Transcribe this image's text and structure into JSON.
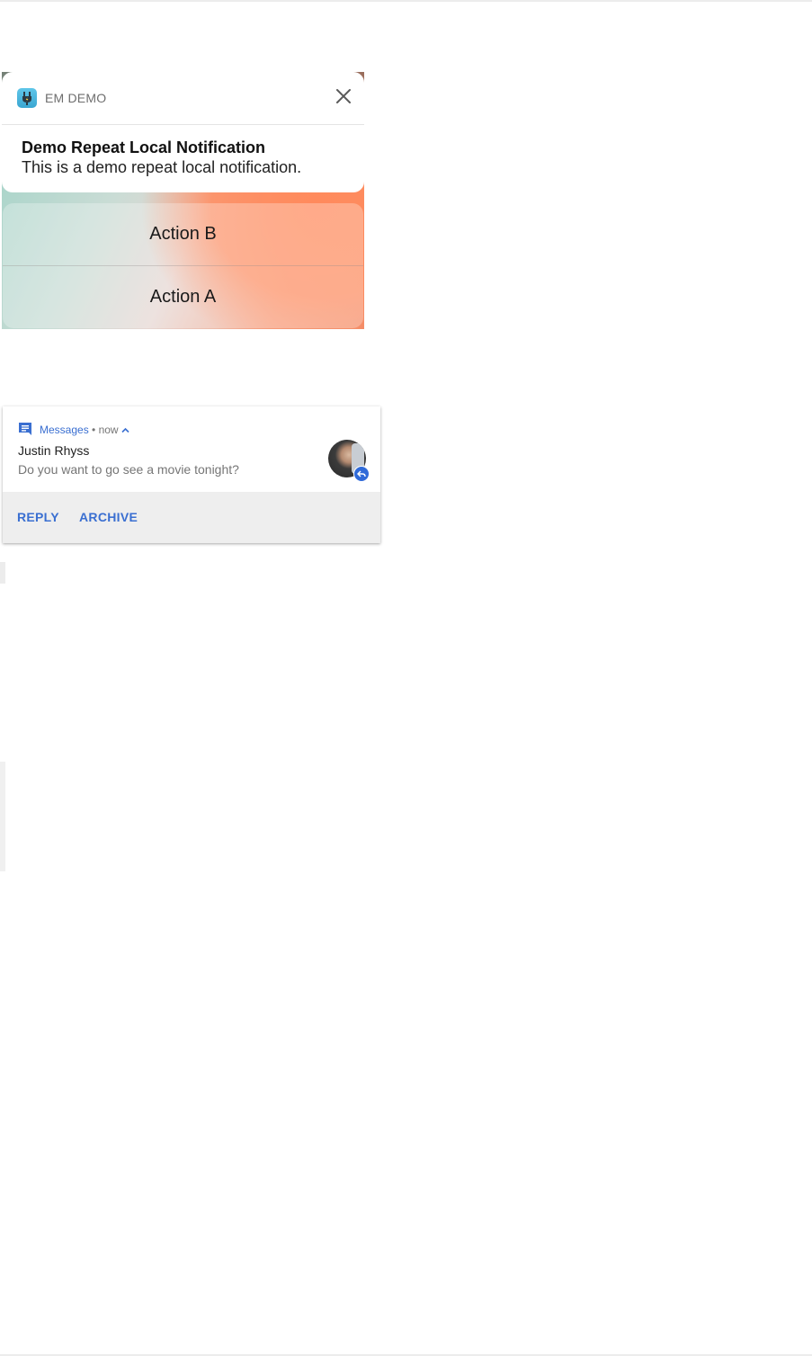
{
  "ios_notification": {
    "app_name": "EM DEMO",
    "app_icon": "plug-icon",
    "close_icon": "close-icon",
    "title": "Demo Repeat Local Notification",
    "body": "This is a demo repeat local notification.",
    "actions": [
      "Action B",
      "Action A"
    ]
  },
  "android_notification": {
    "app_name": "Messages",
    "time": "• now",
    "app_icon": "messages-icon",
    "expand_icon": "chevron-up-icon",
    "sender": "Justin Rhyss",
    "message": "Do you want to go see a movie tonight?",
    "actions": [
      "REPLY",
      "ARCHIVE"
    ],
    "accent_color": "#3a6fd1"
  }
}
